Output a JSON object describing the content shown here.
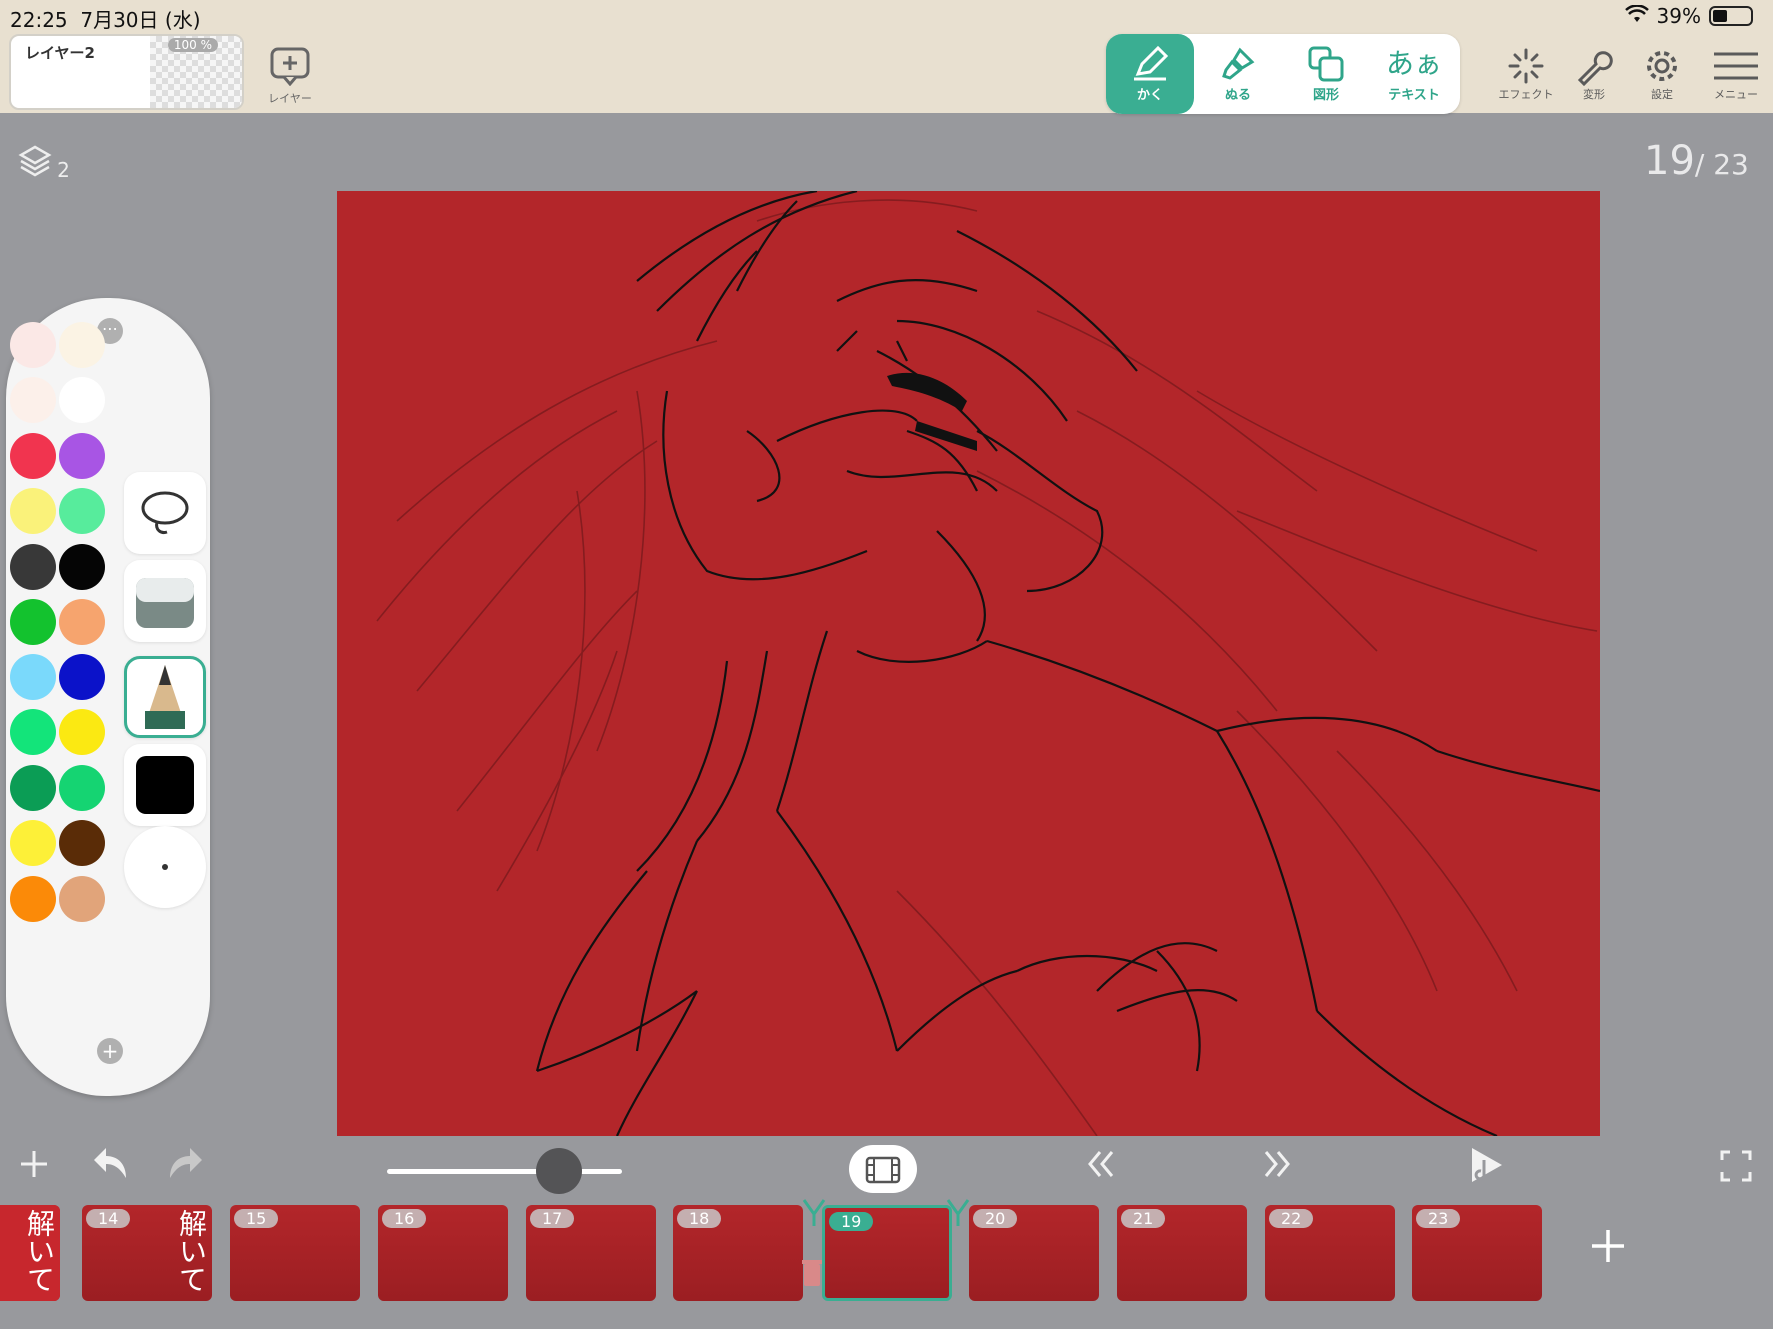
{
  "status": {
    "time": "22:25",
    "date": "7月30日 (水)",
    "battery": "39%"
  },
  "layer": {
    "name": "レイヤー2",
    "opacity": "100 %",
    "add_label": "レイヤー"
  },
  "tools": [
    {
      "label": "かく",
      "icon": "pencil-icon",
      "active": true
    },
    {
      "label": "ぬる",
      "icon": "brush-icon",
      "active": false
    },
    {
      "label": "図形",
      "icon": "shape-icon",
      "active": false
    },
    {
      "label": "テキスト",
      "icon": "text-icon",
      "glyph": "あぁ",
      "active": false
    }
  ],
  "right_tools": [
    {
      "label": "エフェクト",
      "icon": "effect-sparkle-icon"
    },
    {
      "label": "変形",
      "icon": "wrench-icon"
    },
    {
      "label": "設定",
      "icon": "gear-icon"
    },
    {
      "label": "メニュー",
      "icon": "menu-icon"
    }
  ],
  "layer_count": "2",
  "frame_indicator": {
    "current": "19",
    "total": "/ 23"
  },
  "palette": {
    "colors": [
      "#fbe8e6",
      "#fbf3e4",
      "#fcf0ea",
      "#ffffff",
      "#f1344f",
      "#a855e4",
      "#faf27a",
      "#57ec9c",
      "#383838",
      "#050505",
      "#13c22e",
      "#f6a46e",
      "#7ad9fb",
      "#0b12c9",
      "#13e47a",
      "#fbe912",
      "#0b9d55",
      "#15d472",
      "#fdf038",
      "#5a2c07",
      "#fb8a08",
      "#e1a47a"
    ],
    "tools": [
      "lasso-icon",
      "eraser-icon",
      "pencil-tool-icon",
      "color-black",
      "brush-size-dot"
    ]
  },
  "timeline": {
    "frames": [
      "14",
      "15",
      "16",
      "17",
      "18",
      "19",
      "20",
      "21",
      "22",
      "23"
    ],
    "current": "19",
    "title_text": "解いて"
  },
  "colors": {
    "accent": "#3aae92",
    "canvas": "#b3262a",
    "bg": "#98999d"
  }
}
